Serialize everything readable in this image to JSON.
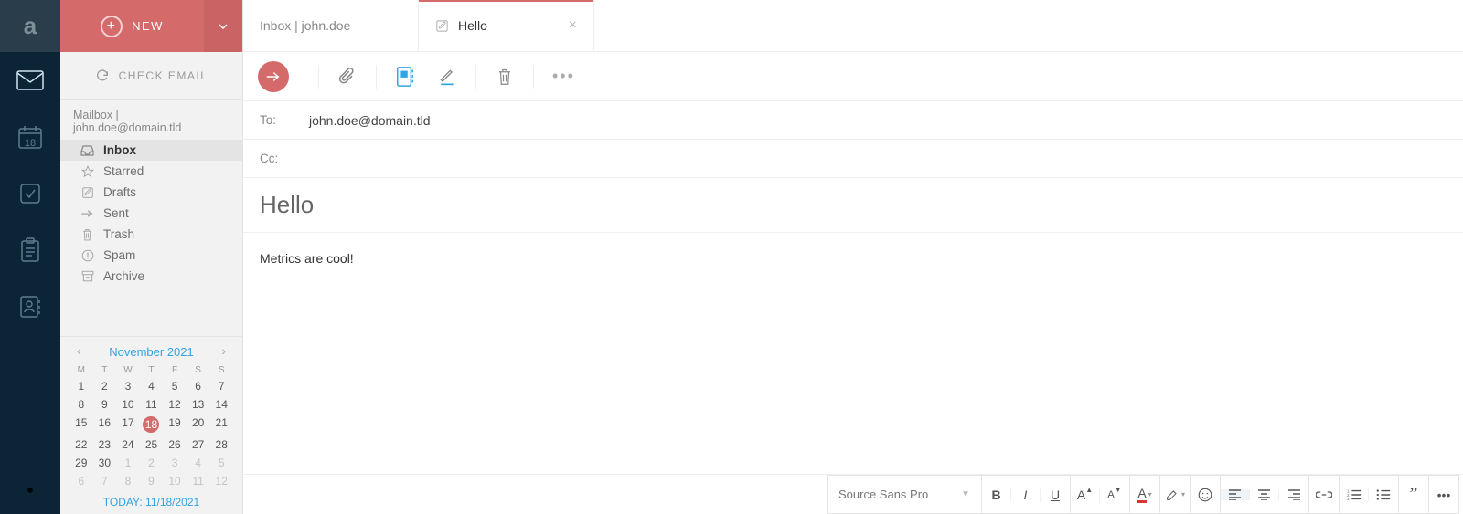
{
  "rail": {
    "calendar_badge": "18"
  },
  "new_button": {
    "label": "NEW"
  },
  "check_email": {
    "label": "CHECK EMAIL"
  },
  "mailbox": {
    "title": "Mailbox | john.doe@domain.tld",
    "folders": [
      {
        "name": "Inbox",
        "active": true
      },
      {
        "name": "Starred"
      },
      {
        "name": "Drafts"
      },
      {
        "name": "Sent"
      },
      {
        "name": "Trash"
      },
      {
        "name": "Spam"
      },
      {
        "name": "Archive"
      }
    ]
  },
  "calendar": {
    "month_label": "November 2021",
    "today_line": "TODAY: 11/18/2021",
    "dow": [
      "M",
      "T",
      "W",
      "T",
      "F",
      "S",
      "S"
    ],
    "weeks": [
      [
        {
          "n": "1"
        },
        {
          "n": "2"
        },
        {
          "n": "3"
        },
        {
          "n": "4"
        },
        {
          "n": "5"
        },
        {
          "n": "6"
        },
        {
          "n": "7"
        }
      ],
      [
        {
          "n": "8"
        },
        {
          "n": "9"
        },
        {
          "n": "10"
        },
        {
          "n": "11"
        },
        {
          "n": "12"
        },
        {
          "n": "13"
        },
        {
          "n": "14"
        }
      ],
      [
        {
          "n": "15"
        },
        {
          "n": "16"
        },
        {
          "n": "17"
        },
        {
          "n": "18",
          "today": true
        },
        {
          "n": "19"
        },
        {
          "n": "20"
        },
        {
          "n": "21"
        }
      ],
      [
        {
          "n": "22"
        },
        {
          "n": "23"
        },
        {
          "n": "24"
        },
        {
          "n": "25"
        },
        {
          "n": "26"
        },
        {
          "n": "27"
        },
        {
          "n": "28"
        }
      ],
      [
        {
          "n": "29"
        },
        {
          "n": "30"
        },
        {
          "n": "1",
          "other": true
        },
        {
          "n": "2",
          "other": true
        },
        {
          "n": "3",
          "other": true
        },
        {
          "n": "4",
          "other": true
        },
        {
          "n": "5",
          "other": true
        }
      ],
      [
        {
          "n": "6",
          "other": true
        },
        {
          "n": "7",
          "other": true
        },
        {
          "n": "8",
          "other": true
        },
        {
          "n": "9",
          "other": true
        },
        {
          "n": "10",
          "other": true
        },
        {
          "n": "11",
          "other": true
        },
        {
          "n": "12",
          "other": true
        }
      ]
    ]
  },
  "tabs": [
    {
      "label": "Inbox | john.doe",
      "icon": "none",
      "active": false,
      "closable": false
    },
    {
      "label": "Hello",
      "icon": "compose",
      "active": true,
      "closable": true
    }
  ],
  "compose": {
    "to_label": "To:",
    "to_value": "john.doe@domain.tld",
    "cc_label": "Cc:",
    "cc_value": "",
    "subject": "Hello",
    "body": "Metrics are cool!"
  },
  "format": {
    "font_name": "Source Sans Pro"
  }
}
